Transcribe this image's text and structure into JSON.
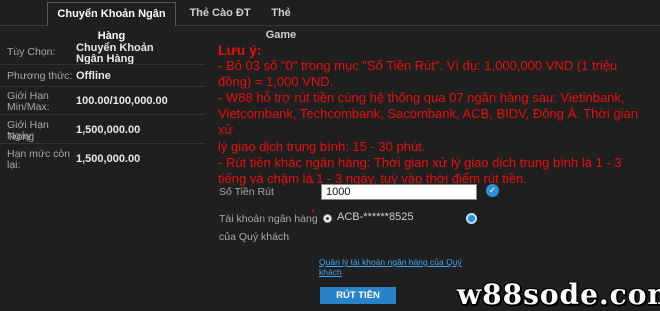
{
  "tabs": [
    {
      "label": "Chuyển Khoản Ngân Hàng",
      "active": true
    },
    {
      "label": "Thẻ Cào ĐT",
      "active": false
    },
    {
      "label": "Thẻ Game",
      "active": false
    }
  ],
  "info": {
    "option_label": "Tùy Chọn:",
    "option_value_line1": "Chuyển Khoản",
    "option_value_line2": "Ngân Hàng",
    "method_label": "Phương thức:",
    "method_value": "Offline",
    "minmax_label_line1": "Giới Hạn",
    "minmax_label_line2": "Min/Max:",
    "minmax_value": "100.00/100,000.00",
    "daily_label_line1": "Giới Hạn Trong",
    "daily_label_line2": "Ngày:",
    "daily_value": "1,500,000.00",
    "remain_label_line1": "Hạn mức còn",
    "remain_label_line2": "lại:",
    "remain_value": "1,500,000.00"
  },
  "note": {
    "title": "Lưu ý:",
    "line1": "- Bỏ 03 số \"0\" trong mục \"Số Tiền Rút\". Ví dụ: 1,000,000 VND (1 triệu",
    "line2": "đồng) = 1,000 VND.",
    "line3": "- W88 hỗ trợ rút tiền cùng hệ thống qua 07 ngân hàng sau: Vietinbank,",
    "line4": "Vietcombank, Techcombank, Sacombank, ACB, BIDV, Đông Á. Thời gian xử",
    "line5": "lý giao dịch trung bình: 15 - 30 phút.",
    "line6": "- Rút tiền khác ngân hàng: Thời gian xử lý giao dịch trung bình là 1 - 3",
    "line7": "tiếng và chậm là 1 - 3 ngày, tuỳ vào thời điểm rút tiền."
  },
  "form": {
    "amount_label": "Số Tiền Rút",
    "required_mark": "*",
    "amount_value": "1000",
    "account_label_line1": "Tài khoản ngân hàng",
    "account_label_line2": "của Quý khách",
    "account_value": "ACB-******8525",
    "manage_link_line1": "Quản lý tài khoản ngân hàng của Quý",
    "manage_link_line2": "khách",
    "submit_label": "RÚT TIỀN"
  },
  "watermark": "w88sode.com",
  "colors": {
    "background": "#1f1f1f",
    "note_red": "#e3110f",
    "accent_blue": "#2b83c7",
    "link_blue": "#3fa9f5"
  },
  "icons": {
    "amount_status": "check-circle-icon",
    "account_status": "selected-dot-icon"
  }
}
